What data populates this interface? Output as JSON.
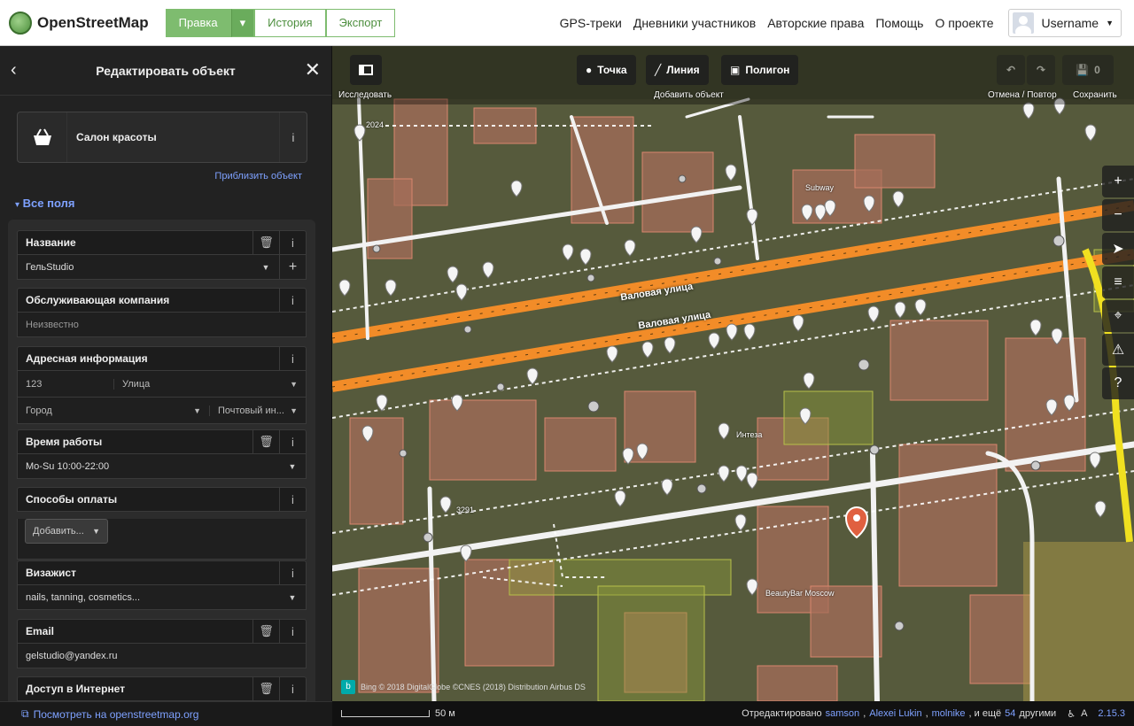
{
  "navbar": {
    "logo_text": "OpenStreetMap",
    "edit_label": "Правка",
    "history_label": "История",
    "export_label": "Экспорт",
    "links": [
      "GPS-треки",
      "Дневники участников",
      "Авторские права",
      "Помощь",
      "О проекте"
    ],
    "username": "Username"
  },
  "sidebar": {
    "title": "Редактировать объект",
    "preset_name": "Салон красоты",
    "zoom_link": "Приблизить объект",
    "all_fields": "Все поля",
    "fields": {
      "name": {
        "label": "Название",
        "value": "ГельStudio"
      },
      "operator": {
        "label": "Обслуживающая компания",
        "placeholder": "Неизвестно"
      },
      "address": {
        "label": "Адресная информация",
        "housenumber": "123",
        "street": "Улица",
        "city": "Город",
        "postcode": "Почтовый ин..."
      },
      "hours": {
        "label": "Время работы",
        "value": "Mo-Su 10:00-22:00"
      },
      "payment": {
        "label": "Способы оплаты",
        "add_label": "Добавить..."
      },
      "makeup": {
        "label": "Визажист",
        "value": "nails, tanning, cosmetics..."
      },
      "email": {
        "label": "Email",
        "value": "gelstudio@yandex.ru"
      },
      "internet": {
        "label": "Доступ в Интернет"
      }
    },
    "footer_link": "Посмотреть на openstreetmap.org"
  },
  "map": {
    "toolbar": {
      "inspect_label": "Исследовать",
      "point_label": "Точка",
      "line_label": "Линия",
      "polygon_label": "Полигон",
      "add_object_label": "Добавить объект",
      "undo_redo_label": "Отмена / Повтор",
      "save_label": "Сохранить",
      "save_count": "0"
    },
    "labels": {
      "street1": "Валовая улица",
      "street2": "Валовая улица",
      "subway": "Subway",
      "inteza": "Интеза",
      "beautybar": "BeautyBar Moscow",
      "num2024": "2024",
      "num3291": "3291"
    },
    "attribution": "Bing © 2018 DigitalGlobe ©CNES (2018) Distribution Airbus DS",
    "footer": {
      "scale": "50 м",
      "edited_by": "Отредактировано",
      "users": [
        "samson",
        "Alexei Lukin",
        "molnike"
      ],
      "and_more": ", и ещё",
      "more_count": "54",
      "others": "другими",
      "version": "2.15.3"
    }
  },
  "colors": {
    "accent": "#7ebc6f",
    "link": "#7ea1ff",
    "road_major": "#f28c28",
    "selected_pin": "#e06040"
  }
}
